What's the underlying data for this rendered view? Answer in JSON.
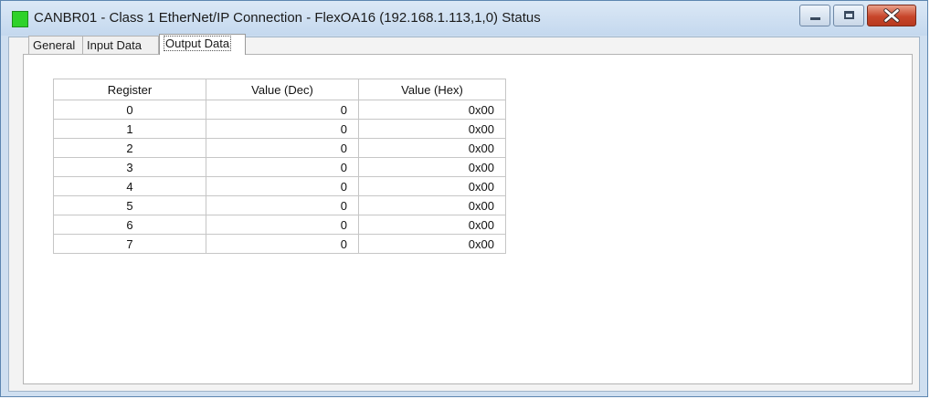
{
  "window": {
    "title": "CANBR01 - Class 1 EtherNet/IP Connection - FlexOA16 (192.168.1.113,1,0) Status",
    "status_color": "#2fd22a"
  },
  "tabs": [
    {
      "label": "General"
    },
    {
      "label": "Input Data"
    },
    {
      "label": "Output Data",
      "selected": true
    }
  ],
  "table": {
    "headers": [
      "Register",
      "Value (Dec)",
      "Value (Hex)"
    ],
    "rows": [
      {
        "register": "0",
        "dec": "0",
        "hex": "0x00"
      },
      {
        "register": "1",
        "dec": "0",
        "hex": "0x00"
      },
      {
        "register": "2",
        "dec": "0",
        "hex": "0x00"
      },
      {
        "register": "3",
        "dec": "0",
        "hex": "0x00"
      },
      {
        "register": "4",
        "dec": "0",
        "hex": "0x00"
      },
      {
        "register": "5",
        "dec": "0",
        "hex": "0x00"
      },
      {
        "register": "6",
        "dec": "0",
        "hex": "0x00"
      },
      {
        "register": "7",
        "dec": "0",
        "hex": "0x00"
      }
    ]
  }
}
